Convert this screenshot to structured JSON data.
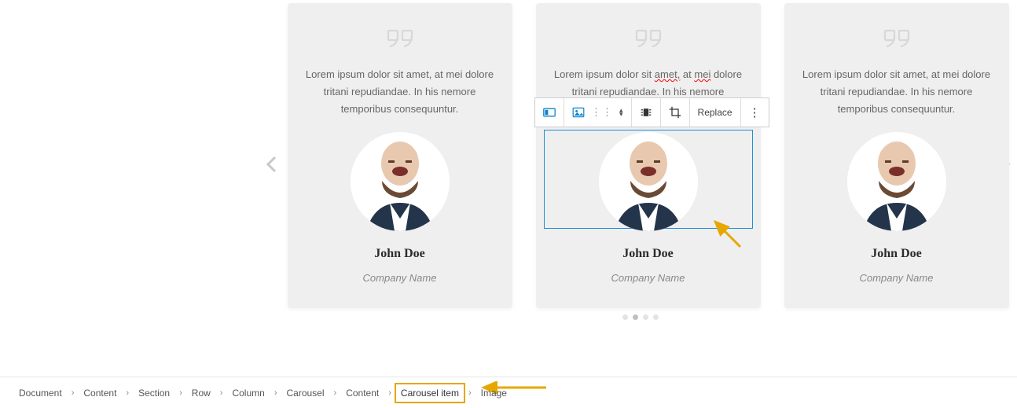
{
  "cards": [
    {
      "text": "Lorem ipsum dolor sit amet, at mei dolore tritani repudiandae. In his nemore temporibus consequuntur.",
      "name": "John Doe",
      "company": "Company Name"
    },
    {
      "text_parts": [
        "Lorem ipsum dolor sit ",
        "amet,",
        " at ",
        "mei",
        " dolore tritani repudiandae. In his nemore temporibus consequuntur."
      ],
      "name": "John Doe",
      "company": "Company Name"
    },
    {
      "text": "Lorem ipsum dolor sit amet, at mei dolore tritani repudiandae. In his nemore temporibus consequuntur.",
      "name": "John Doe",
      "company": "Company Name"
    }
  ],
  "toolbar": {
    "replace_label": "Replace"
  },
  "breadcrumb": {
    "items": [
      "Document",
      "Content",
      "Section",
      "Row",
      "Column",
      "Carousel",
      "Content",
      "Carousel item",
      "Image"
    ],
    "highlight_index": 7
  },
  "carousel": {
    "dot_count": 4,
    "active_dot": 1
  },
  "colors": {
    "accent": "#e6a700",
    "select": "#1f8fd6"
  }
}
